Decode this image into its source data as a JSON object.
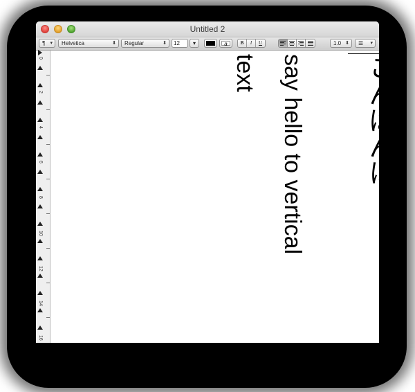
{
  "window": {
    "title": "Untitled 2"
  },
  "toolbar": {
    "paragraph_styles": "¶",
    "font_family": "Helvetica",
    "font_style": "Regular",
    "font_size": "12",
    "bold": "B",
    "italic": "I",
    "underline": "U",
    "line_spacing": "1.0",
    "bg_color_glyph": "a"
  },
  "ruler": {
    "labels": [
      "0",
      "2",
      "4",
      "6",
      "8",
      "10",
      "12",
      "14",
      "16"
    ]
  },
  "document": {
    "lines": [
      "こんばんは",
      "say hello to vertical",
      "text"
    ]
  },
  "colors": {
    "text_color": "#000000"
  }
}
